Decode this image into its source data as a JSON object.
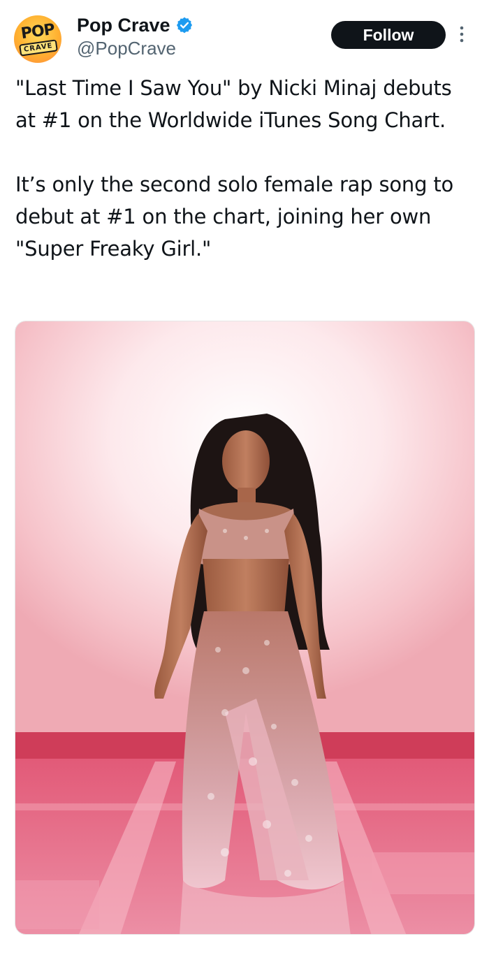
{
  "account": {
    "display_name": "Pop Crave",
    "handle": "@PopCrave",
    "verified": true,
    "avatar_logo_text_top": "POP",
    "avatar_logo_text_bottom": "CRAVE"
  },
  "actions": {
    "follow_label": "Follow",
    "more_icon": "more-vertical-icon"
  },
  "tweet": {
    "paragraphs": [
      "\"Last Time I Saw You\" by Nicki Minaj debuts at #1 on the Worldwide iTunes Song Chart.",
      "It’s only the second solo female rap song to debut at #1 on the chart, joining her own \"Super Freaky Girl.\""
    ]
  },
  "colors": {
    "text_primary": "#0f1419",
    "text_secondary": "#536471",
    "verified_blue": "#1d9bf0",
    "follow_bg": "#0f1419",
    "follow_fg": "#ffffff",
    "photo_backdrop": "#f7c9cf",
    "photo_floor": "#e0607a"
  },
  "icons": {
    "verified": "verified-badge-icon",
    "more": "more-vertical-icon"
  }
}
